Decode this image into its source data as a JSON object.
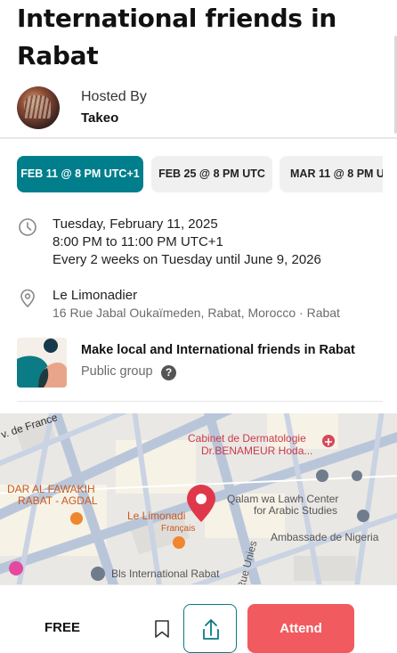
{
  "event": {
    "title": "International friends in Rabat"
  },
  "host": {
    "label": "Hosted By",
    "name": "Takeo"
  },
  "date_chips": [
    {
      "label": "FEB 11 @ 8 PM UTC+1",
      "selected": true
    },
    {
      "label": "FEB 25 @ 8 PM UTC",
      "selected": false
    },
    {
      "label": "MAR 11 @ 8 PM UTC",
      "selected": false
    }
  ],
  "datetime": {
    "icon": "clock-icon",
    "date": "Tuesday, February 11, 2025",
    "time": "8:00 PM to 11:00 PM UTC+1",
    "recurrence": "Every 2 weeks on Tuesday until June 9, 2026"
  },
  "location": {
    "icon": "location-pin-icon",
    "venue": "Le Limonadier",
    "address": "16 Rue Jabal Oukaïmeden, Rabat, Morocco · Rabat"
  },
  "group": {
    "name": "Make local and International friends in Rabat",
    "type": "Public group",
    "help_icon": "?"
  },
  "map": {
    "labels": {
      "street1": "v. de France",
      "clinic_line1": "Cabinet de Dermatologie",
      "clinic_line2": "Dr.BENAMEUR Hoda...",
      "restaurant_line1": "DAR AL FAWAKIH",
      "restaurant_line2": "RABAT - AGDAL",
      "venue_line1": "Le Limonadi",
      "venue_line2": "Français",
      "center_line1": "Qalam wa Lawh Center",
      "center_line2": "for Arabic Studies",
      "street2": "Rue Unies",
      "embassy": "Ambassade de Nigeria",
      "school": "Bls International Rabat"
    },
    "pin_color": "#e0384b"
  },
  "footer": {
    "price": "FREE",
    "attend_label": "Attend",
    "accent": "#f15a5f",
    "teal": "#007e8c"
  }
}
